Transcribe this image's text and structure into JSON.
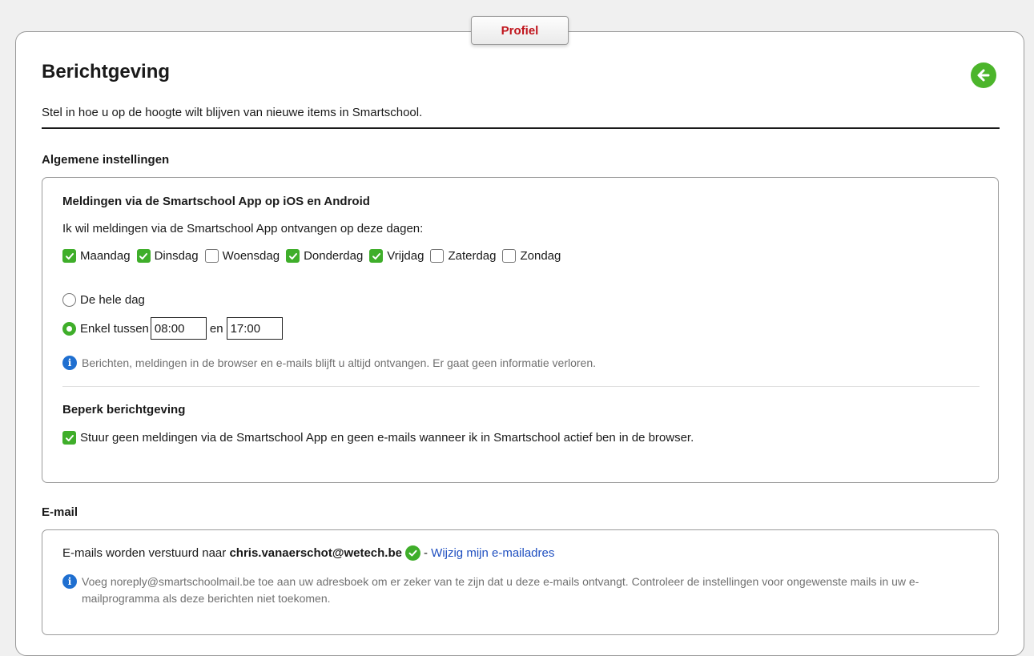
{
  "tab": {
    "label": "Profiel"
  },
  "page": {
    "title": "Berichtgeving",
    "subtitle": "Stel in hoe u op de hoogte wilt blijven van nieuwe items in Smartschool."
  },
  "general": {
    "heading": "Algemene instellingen",
    "app": {
      "title": "Meldingen via de Smartschool App op iOS en Android",
      "days_label": "Ik wil meldingen via de Smartschool App ontvangen op deze dagen:",
      "days": [
        {
          "label": "Maandag",
          "checked": true
        },
        {
          "label": "Dinsdag",
          "checked": true
        },
        {
          "label": "Woensdag",
          "checked": false
        },
        {
          "label": "Donderdag",
          "checked": true
        },
        {
          "label": "Vrijdag",
          "checked": true
        },
        {
          "label": "Zaterdag",
          "checked": false
        },
        {
          "label": "Zondag",
          "checked": false
        }
      ],
      "option_all_day": "De hele dag",
      "option_between": "Enkel tussen",
      "selected_option": "between",
      "time_from": "08:00",
      "time_and": "en",
      "time_to": "17:00",
      "info": "Berichten, meldingen in de browser en e-mails blijft u altijd ontvangen. Er gaat geen informatie verloren."
    },
    "limit": {
      "title": "Beperk berichtgeving",
      "option": "Stuur geen meldingen via de Smartschool App en geen e-mails wanneer ik in Smartschool actief ben in de browser.",
      "checked": true
    }
  },
  "email": {
    "heading": "E-mail",
    "sent_to_label": "E-mails worden verstuurd naar",
    "address": "chris.vanaerschot@wetech.be",
    "separator": "-",
    "change_link": "Wijzig mijn e-mailadres",
    "info": "Voeg noreply@smartschoolmail.be toe aan uw adresboek om er zeker van te zijn dat u deze e-mails ontvangt. Controleer de instellingen voor ongewenste mails in uw e-mailprogramma als deze berichten niet toekomen."
  },
  "colors": {
    "accent_green": "#3fae2a",
    "tab_red": "#c0141c",
    "link_blue": "#1f4fc0",
    "info_blue": "#1f6fd0"
  },
  "icons": {
    "back": "arrow-left-circle-icon",
    "info": "info-icon",
    "verified": "check-circle-icon"
  }
}
